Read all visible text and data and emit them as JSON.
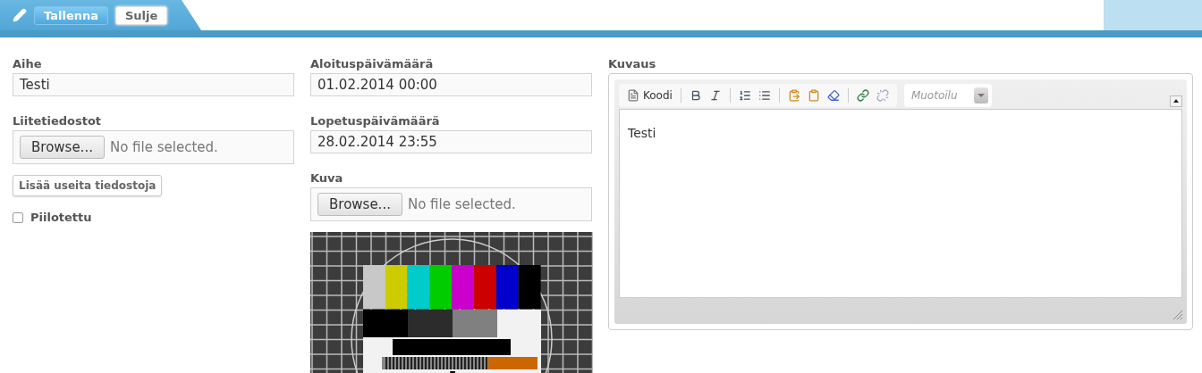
{
  "toolbar": {
    "buttons": [
      {
        "label": "Tallenna",
        "kind": "primary"
      },
      {
        "label": "Sulje",
        "kind": "secondary"
      }
    ]
  },
  "subject": {
    "label": "Aihe",
    "value": "Testi"
  },
  "attachments": {
    "label": "Liitetiedostot",
    "browse": "Browse...",
    "status": "No file selected."
  },
  "add_multiple": "Lisää useita tiedostoja",
  "hidden": {
    "label": "Piilotettu",
    "checked": false
  },
  "start_date": {
    "label": "Aloituspäivämäärä",
    "value": "01.02.2014 00:00"
  },
  "end_date": {
    "label": "Lopetuspäivämäärä",
    "value": "28.02.2014 23:55"
  },
  "image": {
    "label": "Kuva",
    "browse": "Browse...",
    "status": "No file selected."
  },
  "description": {
    "label": "Kuvaus",
    "source_button": "Koodi",
    "format_placeholder": "Muotoilu",
    "content": "Testi"
  }
}
